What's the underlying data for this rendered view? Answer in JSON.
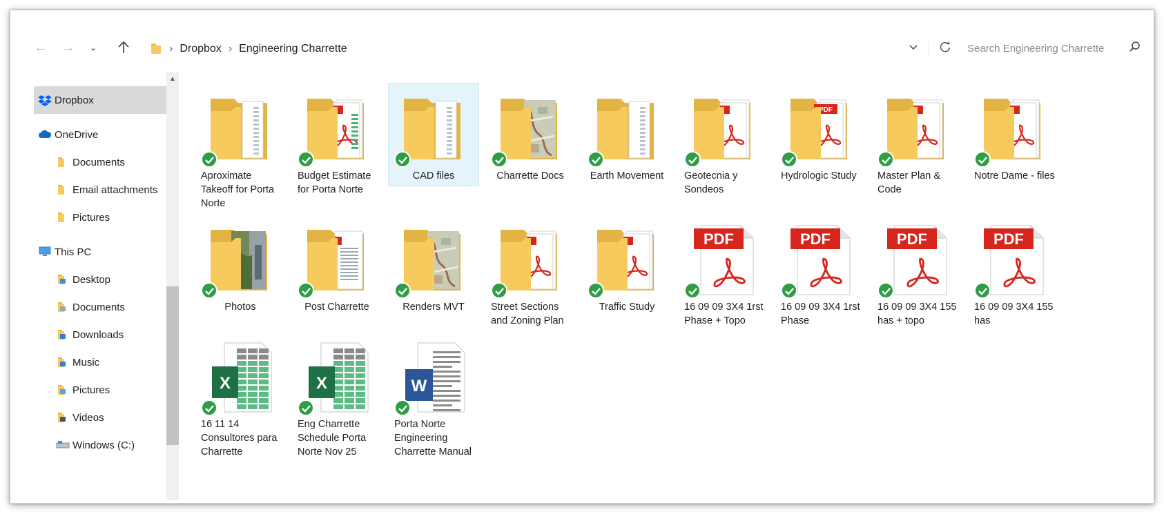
{
  "address": {
    "breadcrumbs": [
      "Dropbox",
      "Engineering Charrette"
    ],
    "search_placeholder": "Search Engineering Charrette"
  },
  "icons": {
    "back": "arrow-left-icon",
    "forward": "arrow-right-icon",
    "recent": "chevron-down-icon",
    "up": "arrow-up-icon",
    "refresh": "refresh-icon",
    "search": "search-icon"
  },
  "colors": {
    "folder": "#f6ca5c",
    "sync_check": "#2e9d45",
    "pdf_red": "#d7261e",
    "excel_green": "#1e7145",
    "word_blue": "#2b579a",
    "selection": "#e5f3fb"
  },
  "navpane": {
    "items": [
      {
        "label": "Dropbox",
        "icon": "dropbox-icon",
        "indent": 0,
        "selected": true
      },
      {
        "label": "OneDrive",
        "icon": "cloud-icon",
        "indent": 0
      },
      {
        "label": "Documents",
        "icon": "folder-icon",
        "indent": 1
      },
      {
        "label": "Email attachments",
        "icon": "folder-icon",
        "indent": 1
      },
      {
        "label": "Pictures",
        "icon": "folder-icon",
        "indent": 1
      },
      {
        "label": "This PC",
        "icon": "computer-icon",
        "indent": 0
      },
      {
        "label": "Desktop",
        "icon": "desktop-folder-icon",
        "indent": 1
      },
      {
        "label": "Documents",
        "icon": "documents-folder-icon",
        "indent": 1
      },
      {
        "label": "Downloads",
        "icon": "downloads-folder-icon",
        "indent": 1
      },
      {
        "label": "Music",
        "icon": "music-folder-icon",
        "indent": 1
      },
      {
        "label": "Pictures",
        "icon": "pictures-folder-icon",
        "indent": 1
      },
      {
        "label": "Videos",
        "icon": "videos-folder-icon",
        "indent": 1
      },
      {
        "label": "Windows (C:)",
        "icon": "drive-icon",
        "indent": 1
      }
    ]
  },
  "files": [
    {
      "name": "Aproximate Takeoff for Porta Norte",
      "kind": "folder-docs"
    },
    {
      "name": "Budget Estimate for Porta Norte",
      "kind": "folder-pdf-sheet"
    },
    {
      "name": "CAD files",
      "kind": "folder-docs",
      "selected": true
    },
    {
      "name": "Charrette Docs",
      "kind": "folder-map"
    },
    {
      "name": "Earth Movement",
      "kind": "folder-docs"
    },
    {
      "name": "Geotecnia y Sondeos",
      "kind": "folder-pdf"
    },
    {
      "name": "Hydrologic Study",
      "kind": "folder-pdf-label"
    },
    {
      "name": "Master Plan & Code",
      "kind": "folder-pdf"
    },
    {
      "name": "Notre Dame - files",
      "kind": "folder-pdf"
    },
    {
      "name": "Photos",
      "kind": "folder-photo"
    },
    {
      "name": "Post Charrette",
      "kind": "folder-doc-blue"
    },
    {
      "name": "Renders MVT",
      "kind": "folder-map"
    },
    {
      "name": "Street Sections and Zoning Plan",
      "kind": "folder-pdf"
    },
    {
      "name": "Traffic Study",
      "kind": "folder-pdf"
    },
    {
      "name": "16 09 09 3X4 1rst Phase + Topo",
      "kind": "pdf"
    },
    {
      "name": "16 09 09 3X4 1rst Phase",
      "kind": "pdf"
    },
    {
      "name": "16 09 09 3X4 155 has + topo",
      "kind": "pdf"
    },
    {
      "name": "16 09 09 3X4 155 has",
      "kind": "pdf"
    },
    {
      "name": "16 11 14 Consultores para Charrette",
      "kind": "excel"
    },
    {
      "name": "Eng Charrette Schedule Porta Norte Nov 25",
      "kind": "excel"
    },
    {
      "name": "Porta Norte Engineering Charrette Manual",
      "kind": "word"
    }
  ],
  "badge_text": {
    "pdf": "PDF",
    "excel": "X",
    "word": "W"
  }
}
